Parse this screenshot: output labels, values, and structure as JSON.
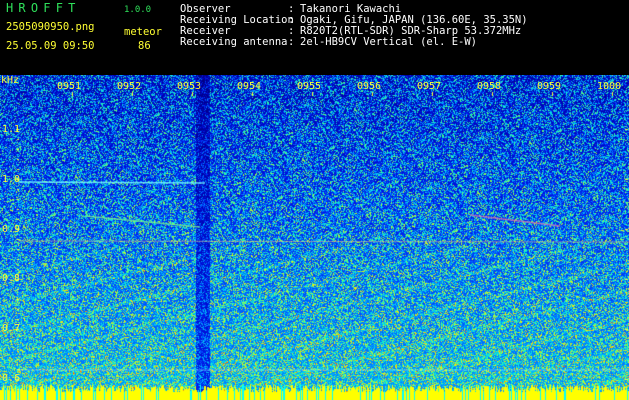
{
  "header": {
    "app_title": "HROFFT",
    "app_version": "1.0.0",
    "file_name": "2505090950.png",
    "datetime": "25.05.09 09:50",
    "mode_label": "meteor",
    "count_value": "86"
  },
  "station": {
    "rows": [
      {
        "label": "Observer",
        "value": "Takanori Kawachi"
      },
      {
        "label": "Receiving Location",
        "value": "Ogaki, Gifu, JAPAN (136.60E, 35.35N)"
      },
      {
        "label": "Receiver",
        "value": "R820T2(RTL-SDR) SDR-Sharp 53.372MHz"
      },
      {
        "label": "Receiving antenna",
        "value": "2el-HB9CV Vertical (el. E-W)"
      }
    ]
  },
  "spectrogram": {
    "y_unit": "kHz",
    "time_ticks": [
      "0951",
      "0952",
      "0953",
      "0954",
      "0955",
      "0956",
      "0957",
      "0958",
      "0959",
      "1000"
    ],
    "freq_ticks": [
      "1.1",
      "1.0",
      "0.9",
      "0.8",
      "0.7",
      "0.6"
    ]
  }
}
